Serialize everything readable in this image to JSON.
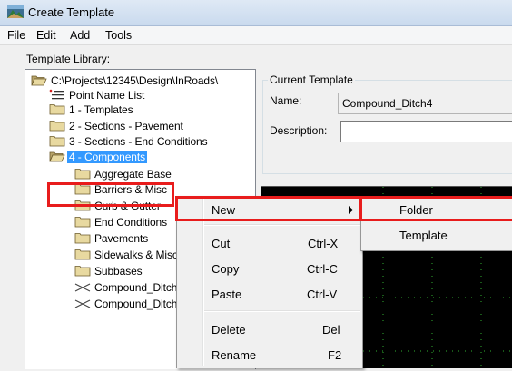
{
  "window": {
    "title": "Create Template"
  },
  "menubar": [
    "File",
    "Edit",
    "Add",
    "Tools"
  ],
  "library": {
    "label": "Template Library:",
    "items": [
      {
        "label": "C:\\Projects\\12345\\Design\\InRoads\\",
        "icon": "open-folder-icon"
      },
      {
        "label": "Point Name List",
        "icon": "point-list-icon"
      },
      {
        "label": "1 - Templates",
        "icon": "folder-icon"
      },
      {
        "label": "2 - Sections - Pavement",
        "icon": "folder-icon"
      },
      {
        "label": "3 - Sections - End Conditions",
        "icon": "folder-icon"
      },
      {
        "label": "4 - Components",
        "icon": "open-folder-icon",
        "selected": true
      },
      {
        "label": "Aggregate Base",
        "icon": "folder-icon"
      },
      {
        "label": "Barriers & Misc",
        "icon": "folder-icon"
      },
      {
        "label": "Curb & Gutter",
        "icon": "folder-icon"
      },
      {
        "label": "End Conditions",
        "icon": "folder-icon"
      },
      {
        "label": "Pavements",
        "icon": "folder-icon"
      },
      {
        "label": "Sidewalks & Misc",
        "icon": "folder-icon"
      },
      {
        "label": "Subbases",
        "icon": "folder-icon"
      },
      {
        "label": "Compound_Ditch",
        "icon": "template-icon"
      },
      {
        "label": "Compound_Ditch",
        "icon": "template-icon"
      }
    ]
  },
  "current": {
    "label": "Current Template",
    "name_label": "Name:",
    "name_value": "Compound_Ditch4",
    "desc_label": "Description:",
    "desc_value": ""
  },
  "context_menu": {
    "items": [
      {
        "label": "New",
        "shortcut": "",
        "submenu": true
      },
      {
        "label": "Cut",
        "shortcut": "Ctrl-X"
      },
      {
        "label": "Copy",
        "shortcut": "Ctrl-C"
      },
      {
        "label": "Paste",
        "shortcut": "Ctrl-V"
      },
      {
        "label": "Delete",
        "shortcut": "Del"
      },
      {
        "label": "Rename",
        "shortcut": "F2"
      }
    ]
  },
  "submenu": {
    "items": [
      "Folder",
      "Template"
    ]
  },
  "colors": {
    "highlight": "#3399ff",
    "callout": "#e81c1c",
    "canvas": "#000000",
    "grid": "#2fae2f"
  }
}
